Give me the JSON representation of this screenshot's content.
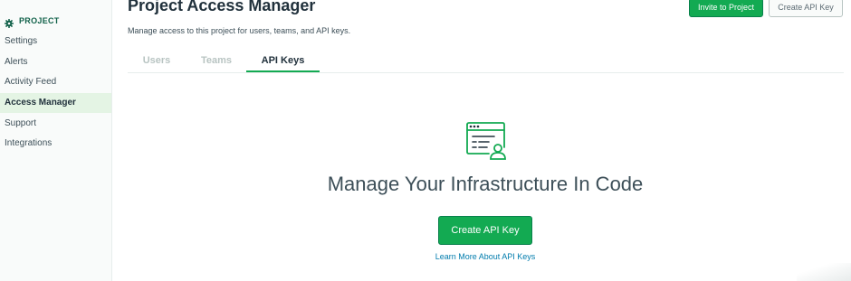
{
  "sidebar": {
    "header": {
      "label": "PROJECT",
      "icon": "gear-icon"
    },
    "items": [
      {
        "label": "Settings",
        "active": false
      },
      {
        "label": "Alerts",
        "active": false
      },
      {
        "label": "Activity Feed",
        "active": false
      },
      {
        "label": "Access Manager",
        "active": true
      },
      {
        "label": "Support",
        "active": false
      },
      {
        "label": "Integrations",
        "active": false
      }
    ]
  },
  "header": {
    "title": "Project Access Manager",
    "subtitle": "Manage access to this project for users, teams, and API keys.",
    "invite_label": "Invite to Project",
    "create_api_key_label": "Create API Key"
  },
  "tabs": [
    {
      "label": "Users",
      "active": false
    },
    {
      "label": "Teams",
      "active": false
    },
    {
      "label": "API Keys",
      "active": true
    }
  ],
  "empty_state": {
    "icon": "api-key-terminal-icon",
    "title": "Manage Your Infrastructure In Code",
    "button_label": "Create API Key",
    "link_label": "Learn More About API Keys"
  },
  "colors": {
    "accent_green": "#13aa52",
    "active_nav_bg": "#e4f4e4",
    "link_blue": "#007cad"
  }
}
